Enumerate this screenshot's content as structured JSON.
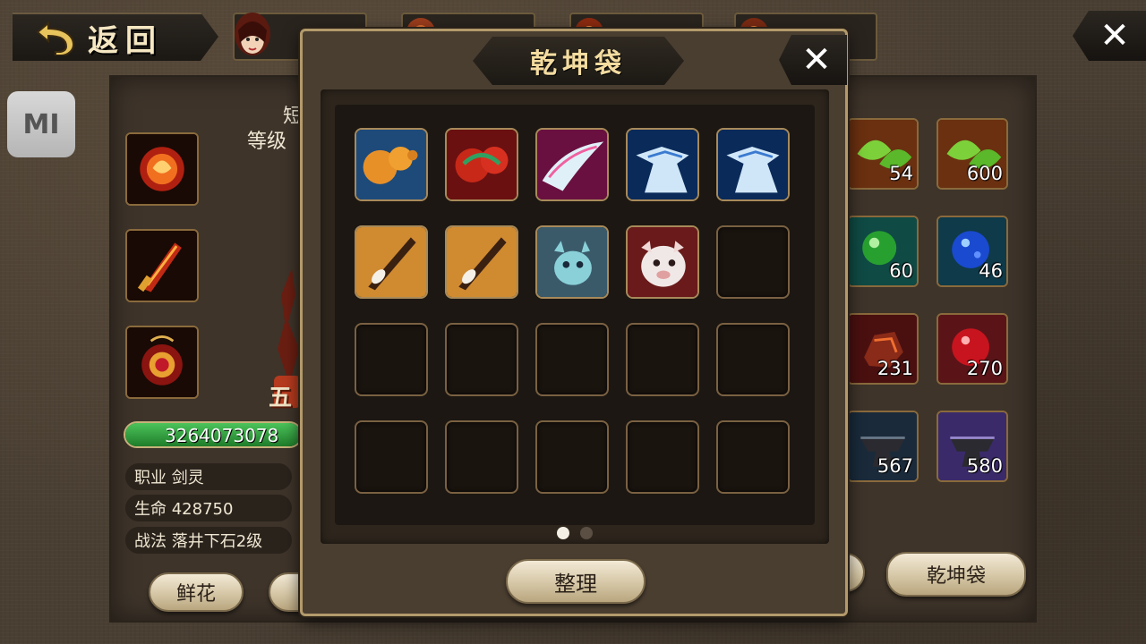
{
  "top_bar": {
    "back_label": "返回"
  },
  "system": {
    "mi_label": "MI"
  },
  "character": {
    "level_label": "等级",
    "partial_text": "短",
    "power_value": "3264073078",
    "class_row": "职业 剑灵",
    "hp_row": "生命 428750",
    "skill_row": "战法 落井下石2级",
    "flower_button": "鲜花",
    "badge_text": "五"
  },
  "right_inventory": {
    "counts": [
      "54",
      "600",
      "60",
      "46",
      "231",
      "270",
      "567",
      "580"
    ],
    "bag_button": "乾坤袋"
  },
  "modal": {
    "title": "乾坤袋",
    "sort_button": "整理",
    "page_current": 1,
    "page_total": 2,
    "items": [
      {
        "icon": "gourd-icon"
      },
      {
        "icon": "red-gourd-icon"
      },
      {
        "icon": "pink-feather-icon"
      },
      {
        "icon": "blue-beast-icon"
      },
      {
        "icon": "blue-beast-icon"
      },
      {
        "icon": "brush-icon"
      },
      {
        "icon": "brush-icon"
      },
      {
        "icon": "dragon-pet-icon"
      },
      {
        "icon": "pig-pet-icon"
      }
    ]
  }
}
